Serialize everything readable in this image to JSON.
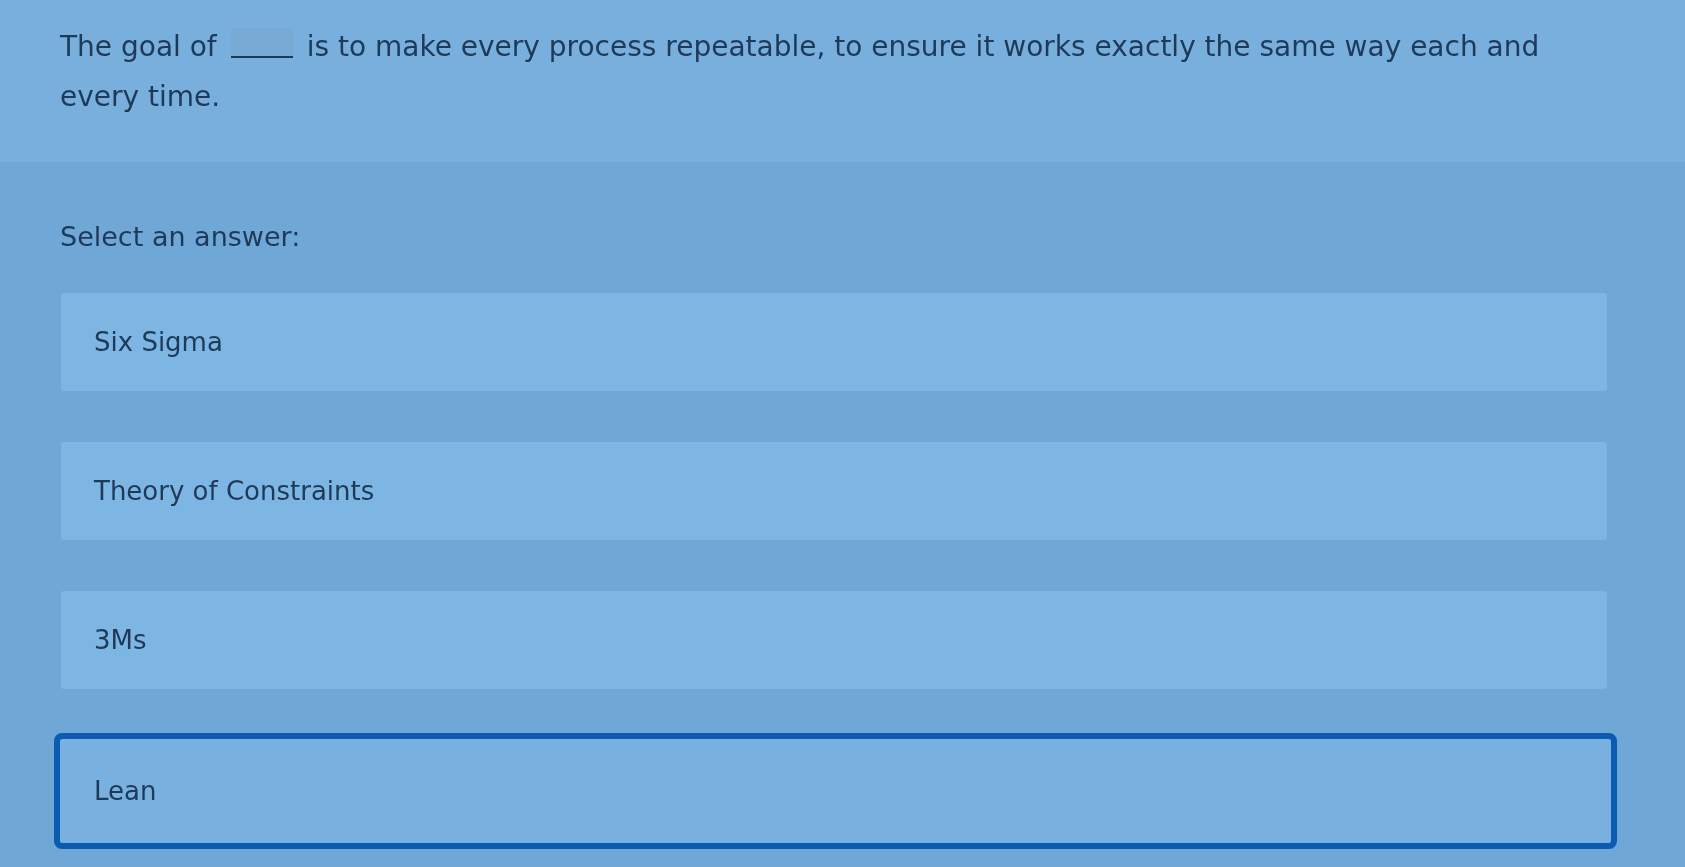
{
  "question": {
    "before_blank": "The goal of",
    "after_blank": "is to make every process repeatable, to ensure it works exactly the same way each and every time."
  },
  "prompt": "Select an answer:",
  "answers": [
    {
      "label": "Six Sigma",
      "selected": false
    },
    {
      "label": "Theory of Constraints",
      "selected": false
    },
    {
      "label": "3Ms",
      "selected": false
    },
    {
      "label": "Lean",
      "selected": true
    }
  ]
}
